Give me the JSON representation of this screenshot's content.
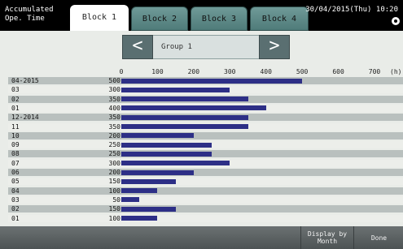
{
  "header": {
    "app_title": "Accumulated\nOpe. Time",
    "tabs": [
      {
        "label": "Block 1"
      },
      {
        "label": "Block 2"
      },
      {
        "label": "Block 3"
      },
      {
        "label": "Block 4"
      }
    ],
    "datetime": "30/04/2015(Thu) 10:20"
  },
  "navigation": {
    "prev_label": "<",
    "group_label": "Group 1",
    "next_label": ">"
  },
  "chart_data": {
    "type": "bar",
    "orientation": "horizontal",
    "unit": "(h)",
    "x_ticks": [
      "0",
      "100",
      "200",
      "300",
      "400",
      "500",
      "600",
      "700"
    ],
    "xlim": [
      0,
      700
    ],
    "categories": [
      "04-2015",
      "03",
      "02",
      "01",
      "12-2014",
      "11",
      "10",
      "09",
      "08",
      "07",
      "06",
      "05",
      "04",
      "03",
      "02",
      "01"
    ],
    "values": [
      500,
      300,
      350,
      400,
      350,
      350,
      200,
      250,
      250,
      300,
      200,
      150,
      100,
      50,
      150,
      100
    ],
    "bar_color": "#2d2f86"
  },
  "footer": {
    "display_by_month": "Display by\nMonth",
    "done": "Done"
  }
}
